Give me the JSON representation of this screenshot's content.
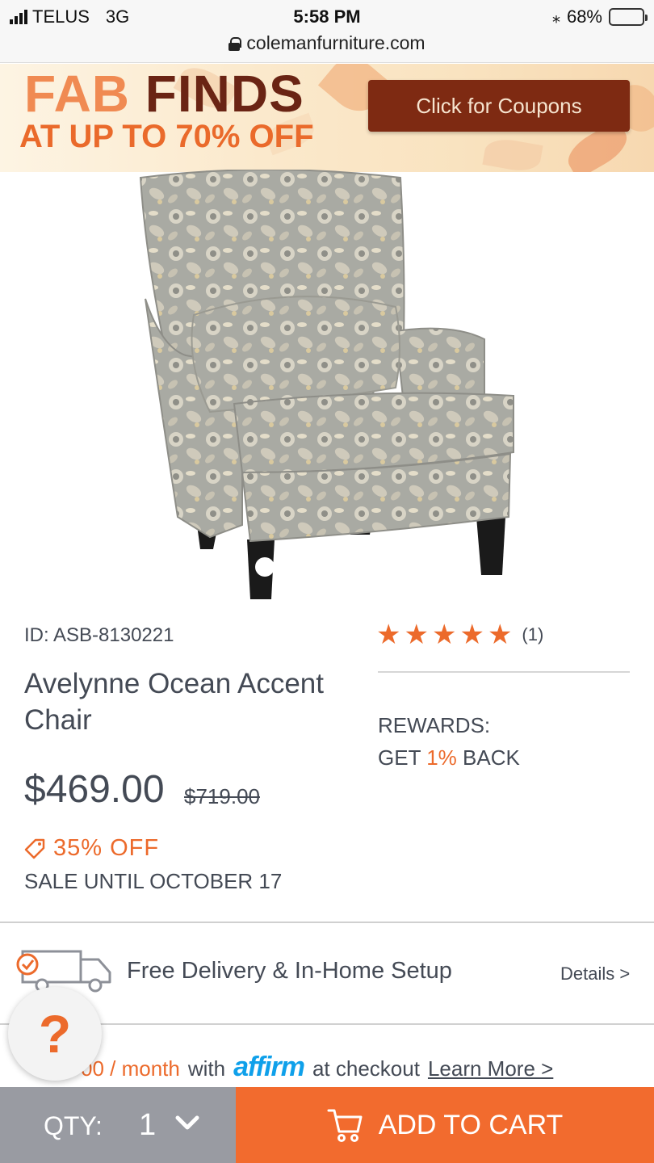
{
  "status_bar": {
    "carrier": "TELUS",
    "network": "3G",
    "time": "5:58 PM",
    "battery": "68%",
    "battery_level": 0.68,
    "url": "colemanfurniture.com"
  },
  "banner": {
    "title_part1": "FAB ",
    "title_part2": "FINDS",
    "subtitle": "AT UP TO 70% OFF",
    "coupon_button": "Click for Coupons"
  },
  "product": {
    "id": "ID: ASB-8130221",
    "name": "Avelynne Ocean Accent Chair",
    "price": "$469.00",
    "original_price": "$719.00",
    "discount": "35% OFF",
    "sale_until": "SALE UNTIL OCTOBER 17",
    "rating_stars": 5,
    "review_count": "(1)",
    "rewards_label": "REWARDS:",
    "rewards_get": "GET ",
    "rewards_pct": "1%",
    "rewards_back": " BACK"
  },
  "delivery": {
    "text": "Free Delivery & In-Home Setup",
    "details_link": "Details >"
  },
  "financing": {
    "amount": "00 / month",
    "with": "with",
    "provider": "affirm",
    "checkout": "at checkout",
    "learn_more": "Learn More >"
  },
  "help": {
    "label": "?"
  },
  "bottom_bar": {
    "qty_label": "QTY:",
    "qty_value": "1",
    "add_to_cart": "ADD TO CART"
  },
  "colors": {
    "accent": "#f26b2e",
    "text": "#444a55",
    "coupon_bg": "#7e2a12",
    "qty_bg": "#999ba2"
  }
}
